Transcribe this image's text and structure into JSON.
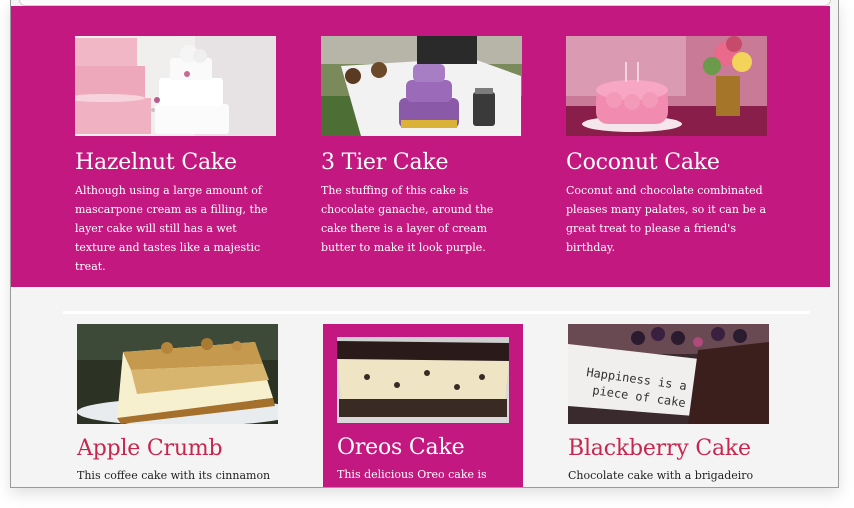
{
  "featured": [
    {
      "title": "Hazelnut Cake",
      "desc": "Although using a large amount of mascarpone cream as a filling, the layer cake will still has a wet texture and tastes like a majestic treat.",
      "image": "hazelnut-cake-photo"
    },
    {
      "title": "3 Tier Cake",
      "desc": "The stuffing of this cake is chocolate ganache, around the cake there is a layer of cream butter to make it look purple.",
      "image": "tier-cake-photo"
    },
    {
      "title": "Coconut Cake",
      "desc": "Coconut and chocolate combinated pleases many palates, so it can be a great treat to please a friend's birthday.",
      "image": "coconut-cake-photo"
    }
  ],
  "more": [
    {
      "title": "Apple Crumb",
      "desc": "This coffee cake with its cinnamon",
      "image": "apple-crumb-photo"
    },
    {
      "title": "Oreos Cake",
      "desc": "This delicious Oreo cake is",
      "image": "oreo-cake-photo"
    },
    {
      "title": "Blackberry Cake",
      "desc": "Chocolate cake with a brigadeiro",
      "image": "blackberry-cake-photo"
    }
  ],
  "colors": {
    "brand": "#c2187f",
    "accent_title": "#c7264f",
    "background": "#f4f4f4"
  }
}
